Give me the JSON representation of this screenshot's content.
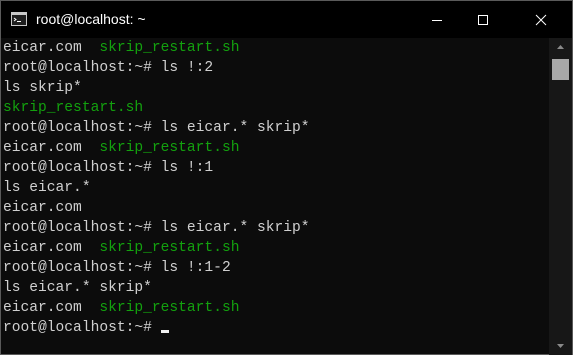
{
  "window": {
    "title": "root@localhost: ~",
    "icon": "terminal-icon",
    "controls": {
      "minimize": "minimize-icon",
      "maximize": "maximize-icon",
      "close": "close-icon"
    }
  },
  "terminal": {
    "lines": [
      {
        "segments": [
          {
            "text": "eicar.com  ",
            "color": "default"
          },
          {
            "text": "skrip_restart.sh",
            "color": "green"
          }
        ]
      },
      {
        "segments": [
          {
            "text": "root@localhost:~# ls !:2",
            "color": "default"
          }
        ]
      },
      {
        "segments": [
          {
            "text": "ls skrip*",
            "color": "default"
          }
        ]
      },
      {
        "segments": [
          {
            "text": "skrip_restart.sh",
            "color": "green"
          }
        ]
      },
      {
        "segments": [
          {
            "text": "root@localhost:~# ls eicar.* skrip*",
            "color": "default"
          }
        ]
      },
      {
        "segments": [
          {
            "text": "eicar.com  ",
            "color": "default"
          },
          {
            "text": "skrip_restart.sh",
            "color": "green"
          }
        ]
      },
      {
        "segments": [
          {
            "text": "root@localhost:~# ls !:1",
            "color": "default"
          }
        ]
      },
      {
        "segments": [
          {
            "text": "ls eicar.*",
            "color": "default"
          }
        ]
      },
      {
        "segments": [
          {
            "text": "eicar.com",
            "color": "default"
          }
        ]
      },
      {
        "segments": [
          {
            "text": "root@localhost:~# ls eicar.* skrip*",
            "color": "default"
          }
        ]
      },
      {
        "segments": [
          {
            "text": "eicar.com  ",
            "color": "default"
          },
          {
            "text": "skrip_restart.sh",
            "color": "green"
          }
        ]
      },
      {
        "segments": [
          {
            "text": "root@localhost:~# ls !:1-2",
            "color": "default"
          }
        ]
      },
      {
        "segments": [
          {
            "text": "ls eicar.* skrip*",
            "color": "default"
          }
        ]
      },
      {
        "segments": [
          {
            "text": "eicar.com  ",
            "color": "default"
          },
          {
            "text": "skrip_restart.sh",
            "color": "green"
          }
        ]
      }
    ],
    "prompt": "root@localhost:~#",
    "colors": {
      "background": "#0c0c0c",
      "default": "#d0d0d0",
      "green": "#13a10e"
    }
  },
  "scrollbar": {
    "up": "scroll-up-arrow-icon",
    "down": "scroll-down-arrow-icon"
  }
}
